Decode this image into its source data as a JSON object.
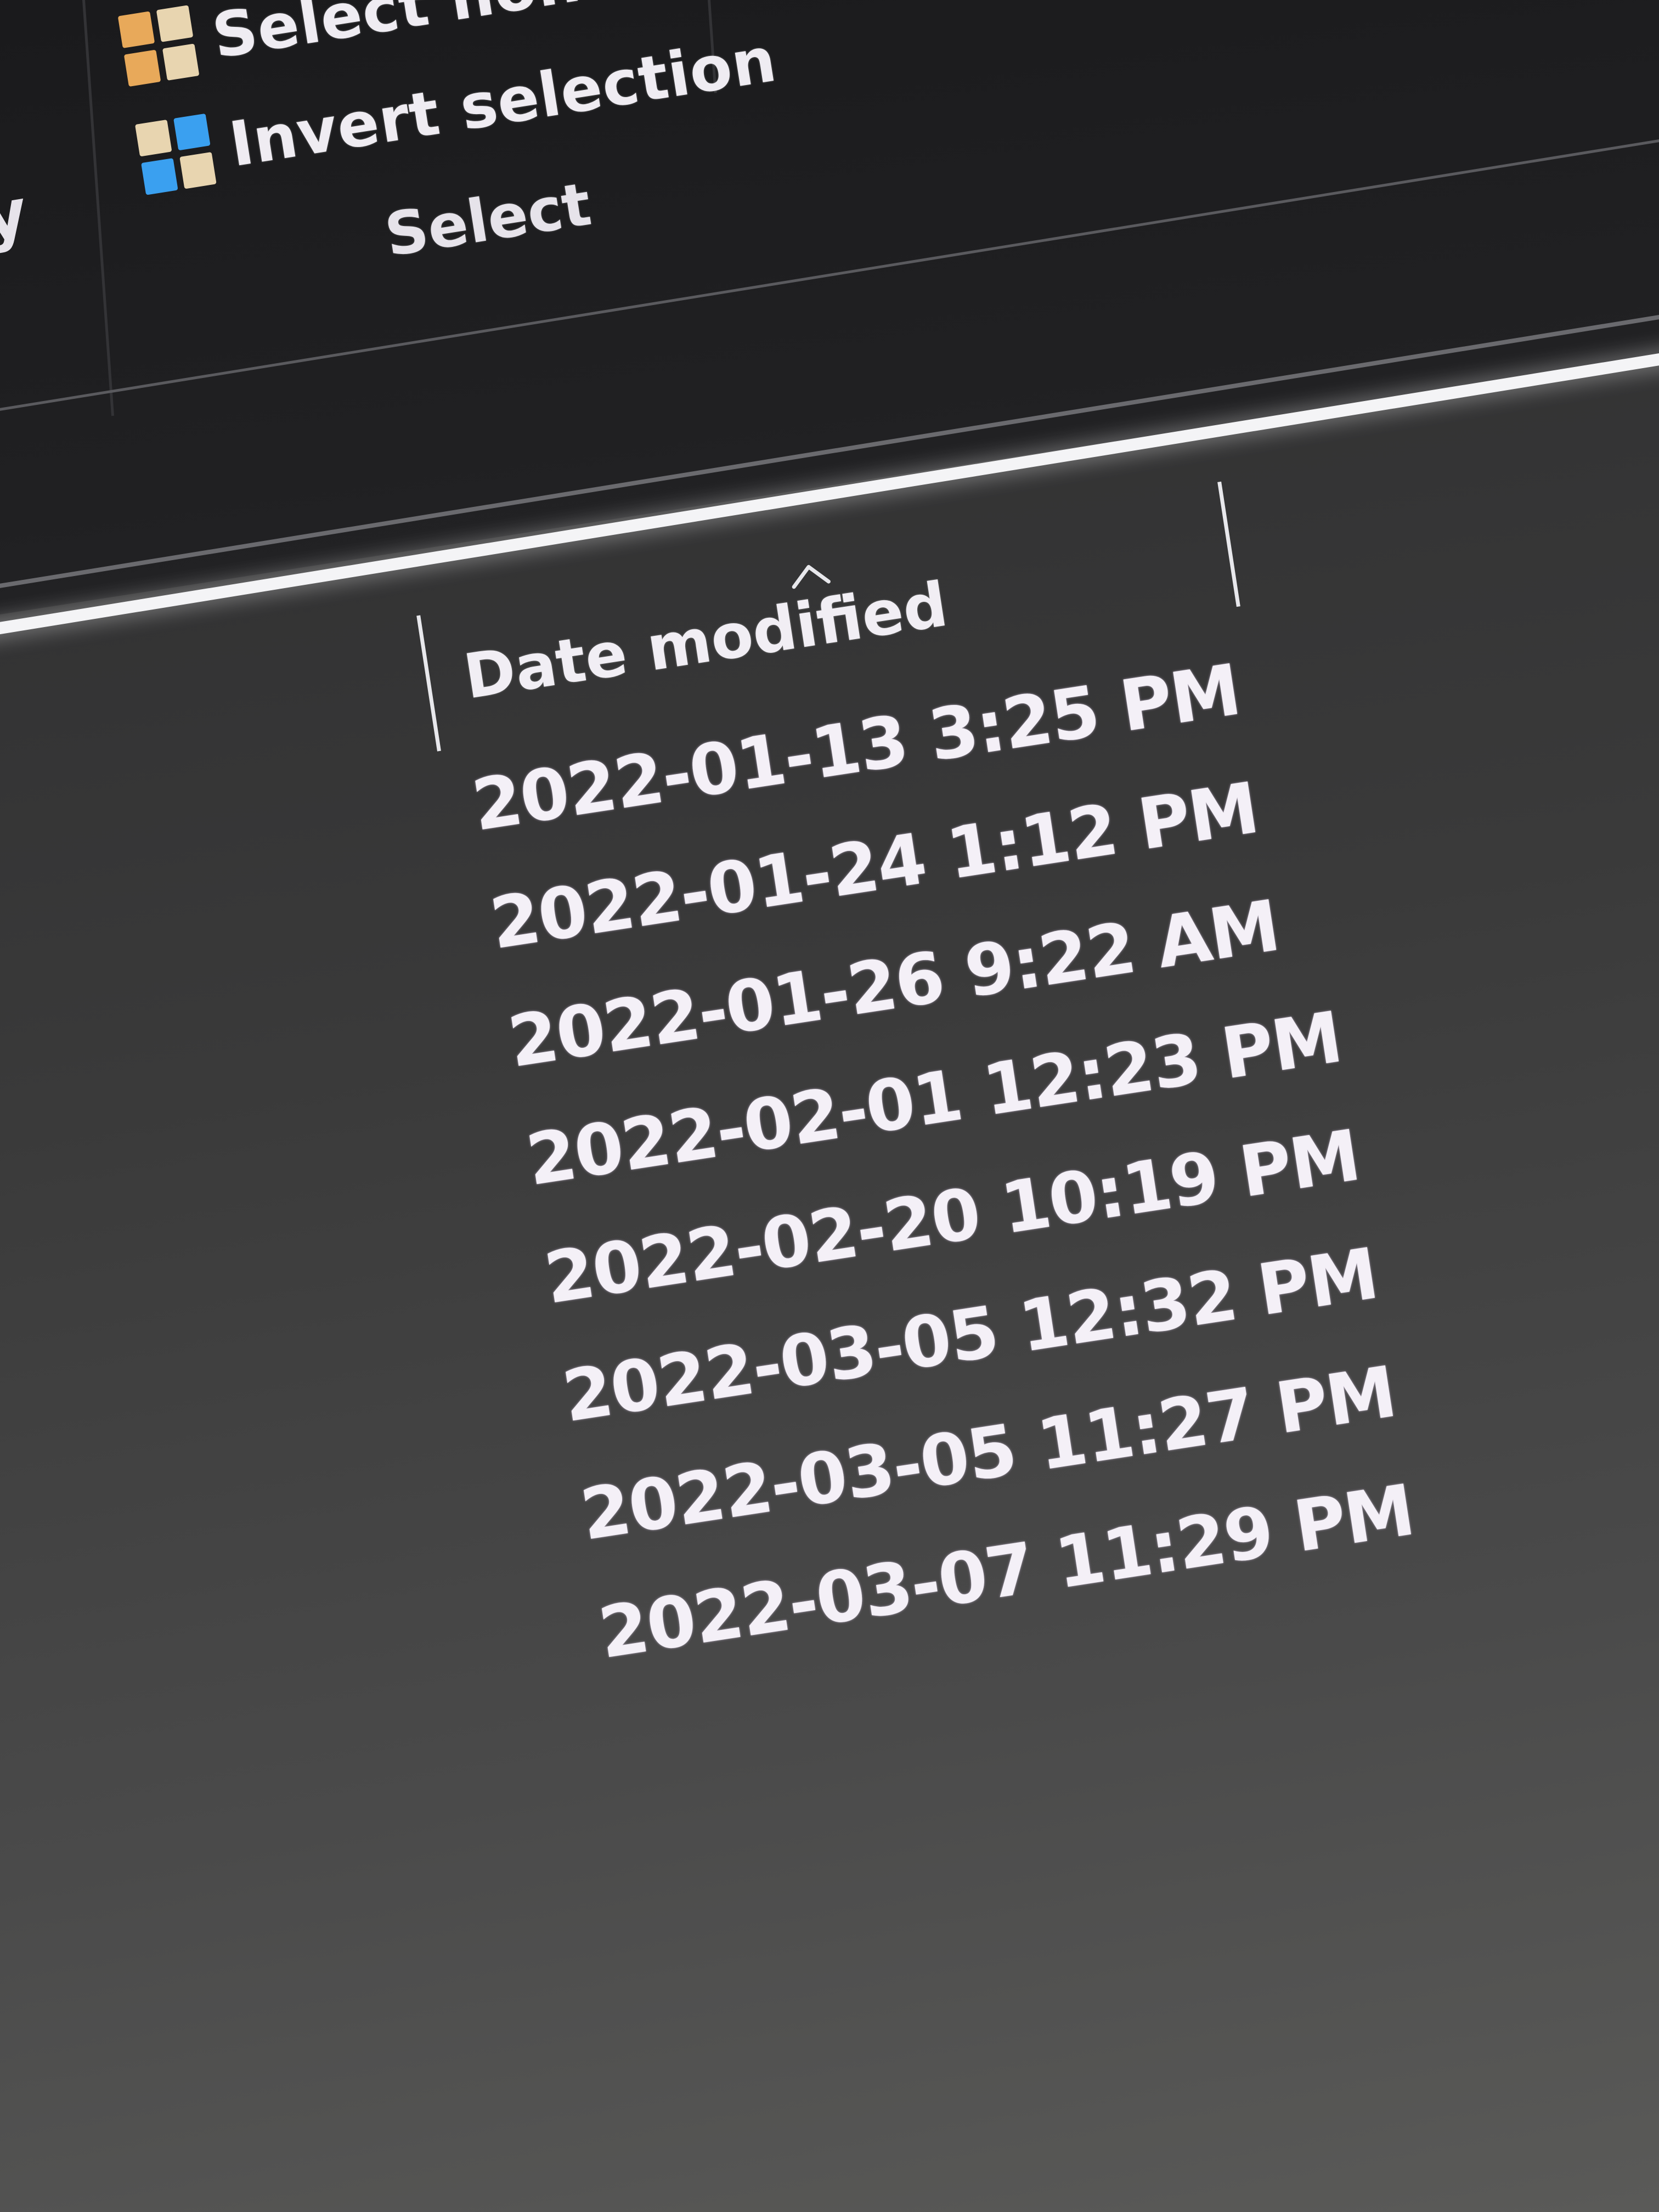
{
  "ribbon": {
    "partial_label": "y",
    "select_group": {
      "caption": "Select",
      "commands": [
        {
          "label": "Select none",
          "icon": "select-none-icon",
          "icon_colors": [
            "#e8a95a",
            "#e8d5b0",
            "#e8a95a",
            "#e8d5b0"
          ]
        },
        {
          "label": "Invert selection",
          "icon": "invert-selection-icon",
          "icon_colors": [
            "#e8d5b0",
            "#3aa0f0",
            "#3aa0f0",
            "#e8d5b0"
          ]
        }
      ]
    }
  },
  "file_list": {
    "column": {
      "title": "Date modified",
      "sort": "ascending"
    },
    "rows": [
      "2022-01-13 3:25 PM",
      "2022-01-24 1:12 PM",
      "2022-01-26 9:22 AM",
      "2022-02-01 12:23 PM",
      "2022-02-20 10:19 PM",
      "2022-03-05 12:32 PM",
      "2022-03-05 11:27 PM",
      "2022-03-07 11:29 PM"
    ]
  }
}
